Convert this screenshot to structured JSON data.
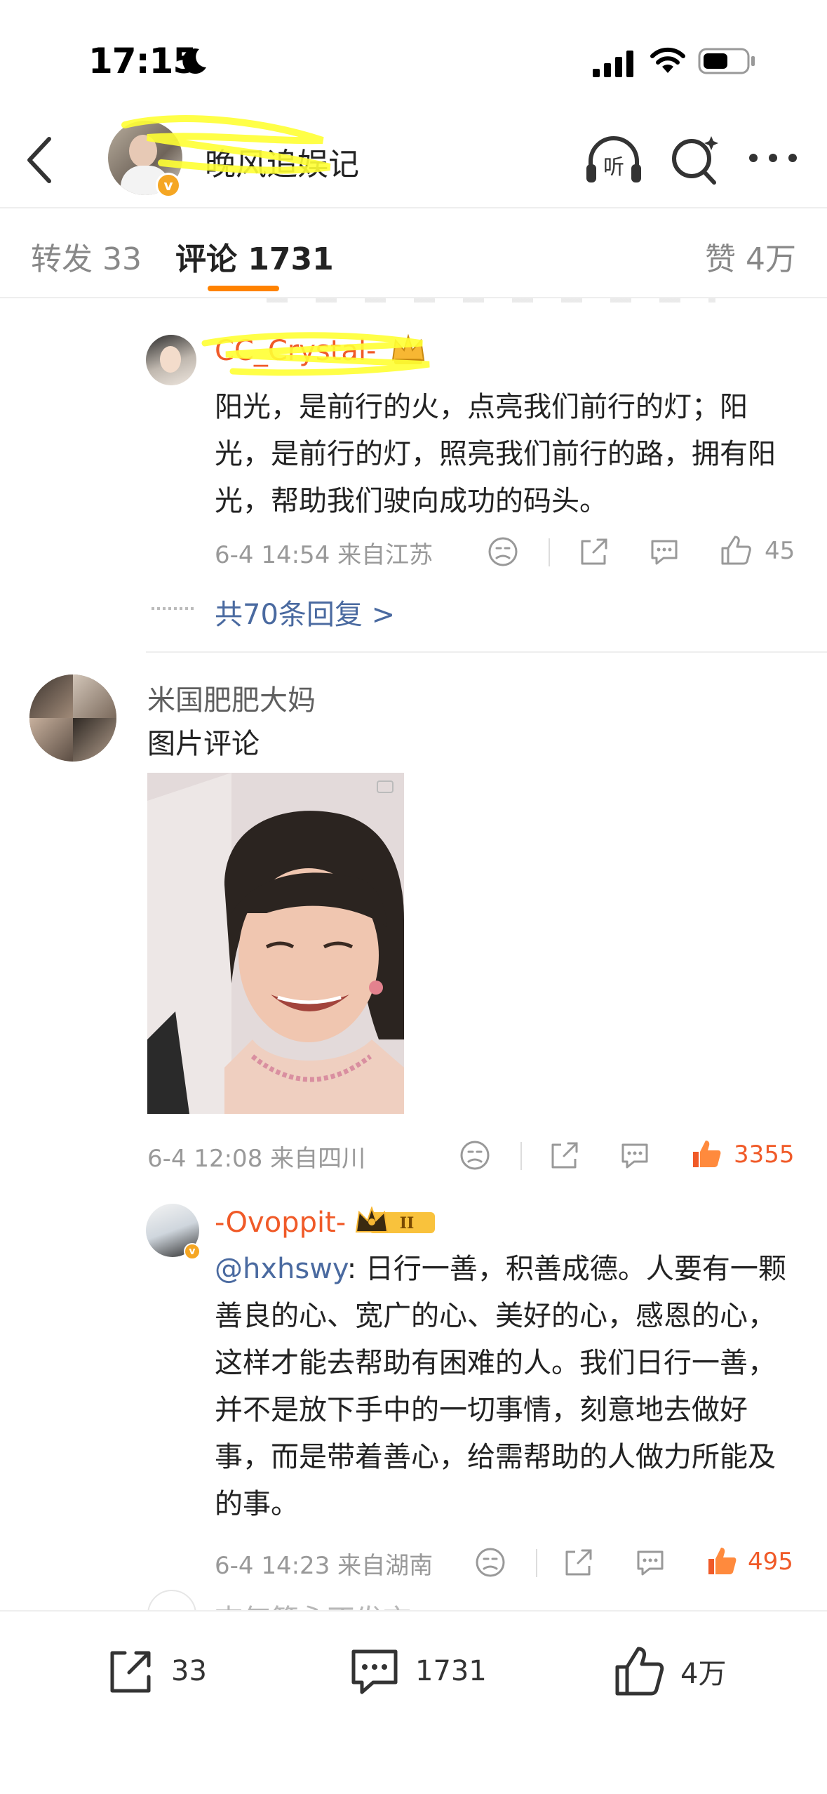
{
  "status_bar": {
    "time": "17:15"
  },
  "header": {
    "title": "晚风追娱记"
  },
  "tabs": [
    {
      "label": "转发 33"
    },
    {
      "label": "评论 1731"
    },
    {
      "label": "赞 4万"
    }
  ],
  "comments": [
    {
      "username": "CC_Crystal-",
      "text": "阳光，是前行的火，点亮我们前行的灯；阳光，是前行的灯，照亮我们前行的路，拥有阳光，帮助我们驶向成功的码头。",
      "meta": "6-4 14:54  来自江苏",
      "likes": "45",
      "replies_link": "共70条回复 >"
    },
    {
      "username": "米国肥肥大妈",
      "text": "图片评论",
      "meta": "6-4 12:08  来自四川",
      "likes": "3355"
    },
    {
      "username": "-Ovoppit-",
      "level": "II",
      "mention": "@hxhswy",
      "text": ": 日行一善，积善成德。人要有一颗善良的心、宽广的心、美好的心，感恩的心，这样才能去帮助有困难的人。我们日行一善，并不是放下手中的一切事情，刻意地去做好事，而是带着善心，给需帮助的人做力所能及的事。",
      "meta": "6-4 14:23  来自湖南",
      "likes": "495"
    }
  ],
  "next_comment_partial": "志气箭永不发言",
  "toolbar": {
    "shares": "33",
    "comments": "1731",
    "likes": "4万"
  },
  "colors": {
    "accent": "#ff8200",
    "hot": "#f05a28",
    "link": "#4a6aa0",
    "highlight": "#ffff33"
  }
}
